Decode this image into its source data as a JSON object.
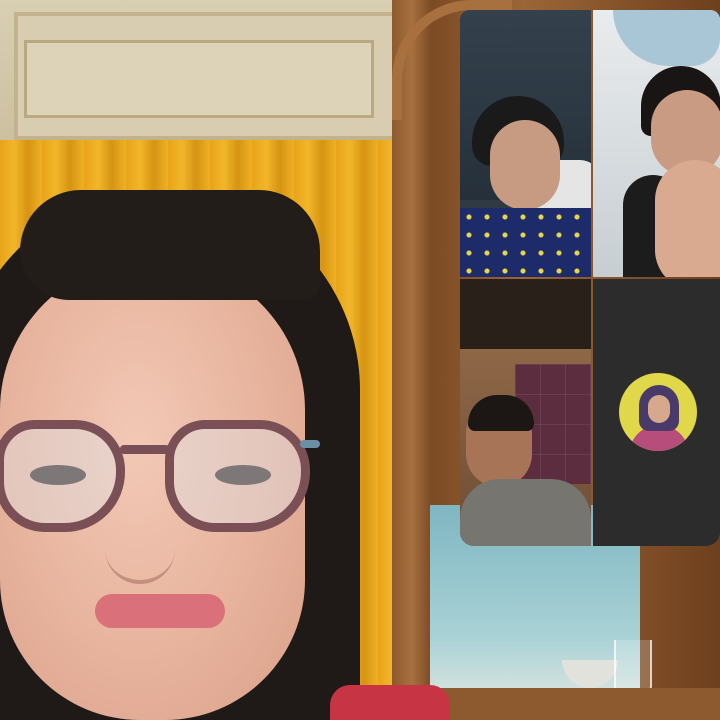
{
  "call": {
    "self_view": {
      "role": "self-view camera feed",
      "label": ""
    },
    "participants": [
      {
        "tile": 1,
        "video": true,
        "label": ""
      },
      {
        "tile": 2,
        "video": true,
        "label": ""
      },
      {
        "tile": 3,
        "video": true,
        "label": ""
      },
      {
        "tile": 4,
        "video": false,
        "label": "",
        "avatar_icon": "avatar-photo"
      }
    ]
  },
  "colors": {
    "curtain": "#f2b62a",
    "door_wood": "#9b6636",
    "tile_off_bg": "#2c2c2c",
    "avatar_bg": "#e0d84a"
  }
}
